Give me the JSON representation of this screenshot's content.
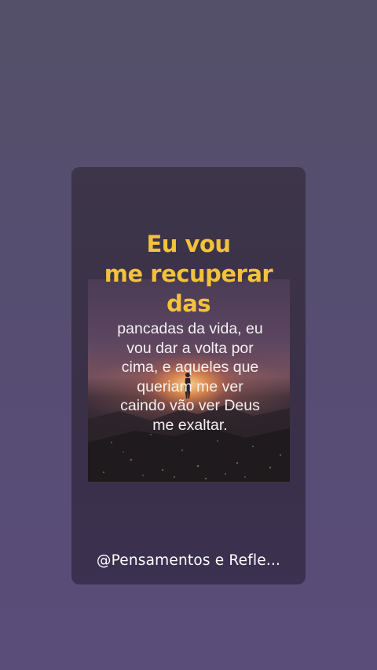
{
  "card": {
    "headline_lines": [
      "Eu vou",
      "me recuperar",
      "das"
    ],
    "body_lines": [
      "pancadas da vida, eu",
      "vou dar a volta por",
      "cima, e aqueles que",
      "queriam me ver",
      "caindo vão ver Deus",
      "me exaltar."
    ],
    "handle": "@Pensamentos e Refle..."
  },
  "colors": {
    "background": "#574d73",
    "card": "#3b3249",
    "headline": "#f2c23b",
    "body_text": "#f4f0f2"
  }
}
